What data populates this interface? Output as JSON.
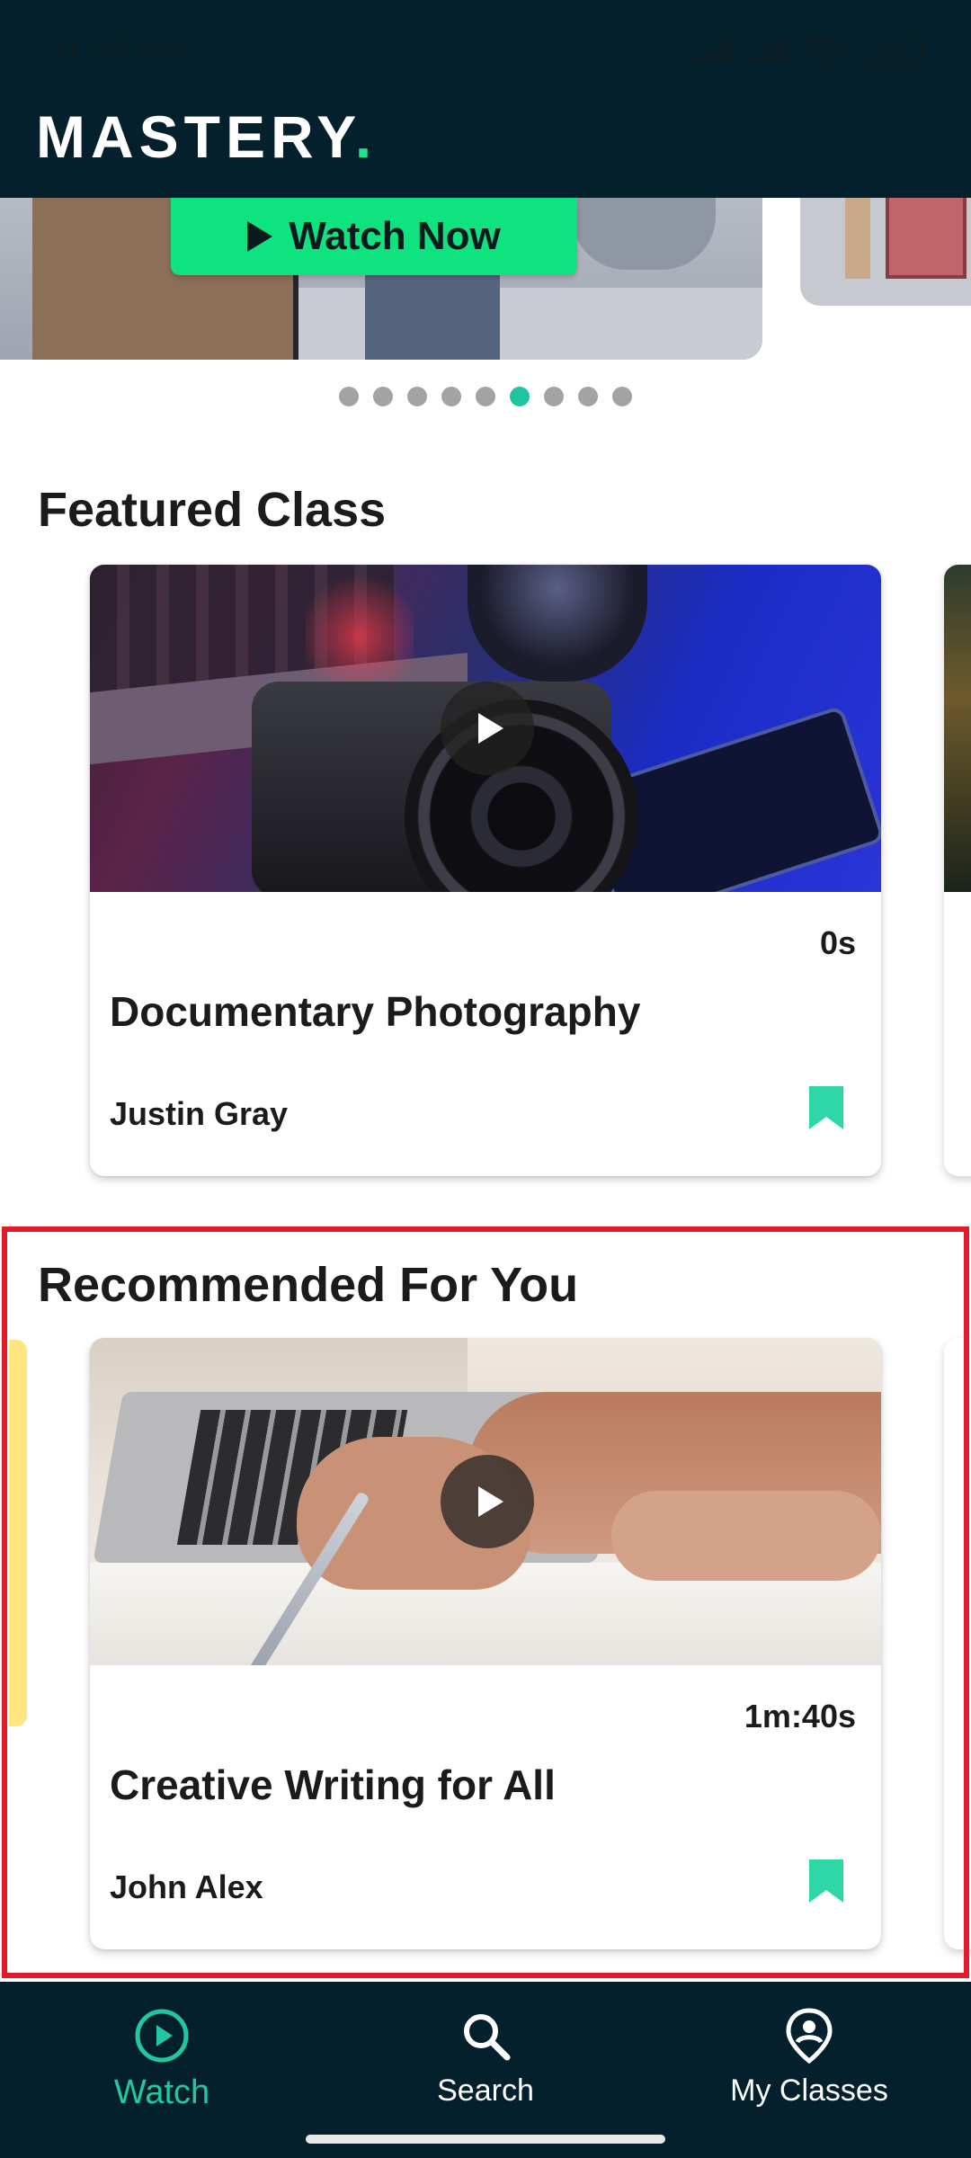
{
  "status_bar": {
    "time": "11:23 AM",
    "battery": "86"
  },
  "app": {
    "logo_text": "MASTERY",
    "logo_dot": "."
  },
  "hero": {
    "button_label": "Watch Now",
    "dots_count": 9,
    "active_dot_index": 5
  },
  "featured": {
    "section_title": "Featured Class",
    "card": {
      "duration": "0s",
      "title": "Documentary Photography",
      "author": "Justin Gray"
    }
  },
  "recommended": {
    "section_title": "Recommended For You",
    "card": {
      "duration": "1m:40s",
      "title": "Creative Writing for All",
      "author": "John Alex"
    }
  },
  "bottom_nav": {
    "items": [
      {
        "label": "Watch",
        "icon": "play-circle-icon",
        "active": true
      },
      {
        "label": "Search",
        "icon": "search-icon",
        "active": false
      },
      {
        "label": "My Classes",
        "icon": "location-person-icon",
        "active": false
      }
    ]
  },
  "colors": {
    "header_bg": "#03202c",
    "brand_green": "#1ee38f",
    "accent_teal": "#22c7a0",
    "bookmark": "#2fd6a6",
    "highlight": "#e21b2b"
  }
}
